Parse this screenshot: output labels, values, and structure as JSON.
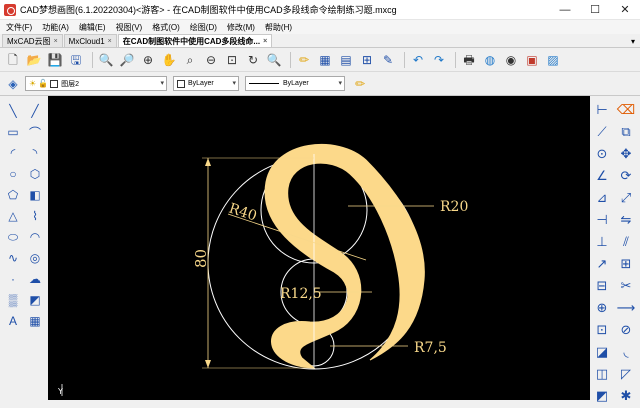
{
  "window": {
    "title": "CAD梦想画图(6.1.20220304)<游客> - 在CAD制图软件中使用CAD多段线命令绘制练习题.mxcg",
    "minimize": "—",
    "maximize": "☐",
    "close": "✕"
  },
  "menu": [
    "文件(F)",
    "功能(A)",
    "编辑(E)",
    "视图(V)",
    "格式(O)",
    "绘图(D)",
    "修改(M)",
    "帮助(H)"
  ],
  "tabs": [
    {
      "label": "MxCAD云图",
      "close": "×"
    },
    {
      "label": "MxCloud1",
      "close": "×"
    },
    {
      "label": "在CAD制图软件中使用CAD多段线命...",
      "close": "×"
    }
  ],
  "tab_dropdown": "▾",
  "layer_toolbar": {
    "layer": "图层2",
    "color": "ByLayer",
    "linetype": "ByLayer",
    "dropdown": "▾"
  },
  "toolbar1_icons": [
    "new-icon",
    "open-icon",
    "save-icon",
    "saveas-icon",
    "zoom-window-icon",
    "zoom-extents-icon",
    "zoom-in-icon",
    "pan-icon",
    "zoom-realtime-icon",
    "zoom-previous-icon",
    "zoom-all-icon",
    "redraw-icon",
    "zoom-icon",
    "pencil-icon",
    "properties-icon",
    "layers-icon",
    "insert-icon",
    "edit-icon",
    "undo-icon",
    "redo-icon",
    "print-icon",
    "web-icon",
    "globe-icon",
    "pdf-icon",
    "image-icon"
  ],
  "toolbar1_glyphs": [
    "🗋",
    "📂",
    "💾",
    "🖫",
    "🔍",
    "🔎",
    "⊕",
    "✋",
    "⌕",
    "⊖",
    "⊡",
    "↻",
    "🔍",
    "✏",
    "▦",
    "▤",
    "⊞",
    "✎",
    "↶",
    "↷",
    "🖶",
    "◍",
    "◉",
    "▣",
    "▨"
  ],
  "left_icons_col1": [
    "line-icon",
    "rectangle-icon",
    "arc-icon",
    "circle-icon",
    "polygon-icon",
    "triangle-icon",
    "ellipse-icon",
    "spline-icon",
    "point-icon",
    "hatch-icon",
    "text-icon"
  ],
  "left_glyphs_col1": [
    "╲",
    "▭",
    "◜",
    "○",
    "⬠",
    "△",
    "⬭",
    "∿",
    "·",
    "▒",
    "A"
  ],
  "left_icons_col2": [
    "xline-icon",
    "polyline-icon",
    "arc3p-icon",
    "polygon2-icon",
    "block-icon",
    "curve-icon",
    "ellipse-arc-icon",
    "donut-icon",
    "revcloud-icon",
    "region-icon",
    "table-icon"
  ],
  "left_glyphs_col2": [
    "╱",
    "⌒",
    "◝",
    "⬡",
    "◧",
    "⌇",
    "◠",
    "◎",
    "☁",
    "◩",
    "▦"
  ],
  "right_icons_col1": [
    "dim-linear-icon",
    "dim-aligned-icon",
    "dim-radius-icon",
    "dim-angular-icon",
    "dim-ordinate-icon",
    "dim-continue-icon",
    "dim-baseline-icon",
    "dim-leader-icon",
    "tolerance-icon",
    "center-mark-icon",
    "dim-edit-icon",
    "dim-style-icon",
    "dim-update-icon",
    "dim-override-icon"
  ],
  "right_glyphs_col1": [
    "⊢",
    "⟋",
    "⊙",
    "∠",
    "⊿",
    "⊣",
    "⊥",
    "↗",
    "⊟",
    "⊕",
    "⊡",
    "◪",
    "◫",
    "◩"
  ],
  "right_icons_col2": [
    "erase-icon",
    "copy-icon",
    "move-icon",
    "rotate-icon",
    "scale-icon",
    "mirror-icon",
    "offset-icon",
    "array-icon",
    "trim-icon",
    "extend-icon",
    "break-icon",
    "fillet-icon",
    "chamfer-icon",
    "explode-icon"
  ],
  "right_glyphs_col2": [
    "⌫",
    "⧉",
    "✥",
    "⟳",
    "⤢",
    "⇋",
    "⫽",
    "⊞",
    "✂",
    "⟶",
    "⊘",
    "◟",
    "◸",
    "✱"
  ],
  "colors": {
    "canvas": "#000000",
    "drawing_fill": "#fcd98a",
    "drawing_line": "#ffffff",
    "dimension": "#f8d88a"
  },
  "drawing": {
    "dim_vertical": "80",
    "dim_r40": "R40",
    "dim_r20": "R20",
    "dim_r125": "R12,5",
    "dim_r75": "R7,5"
  },
  "axis_label": "Y"
}
